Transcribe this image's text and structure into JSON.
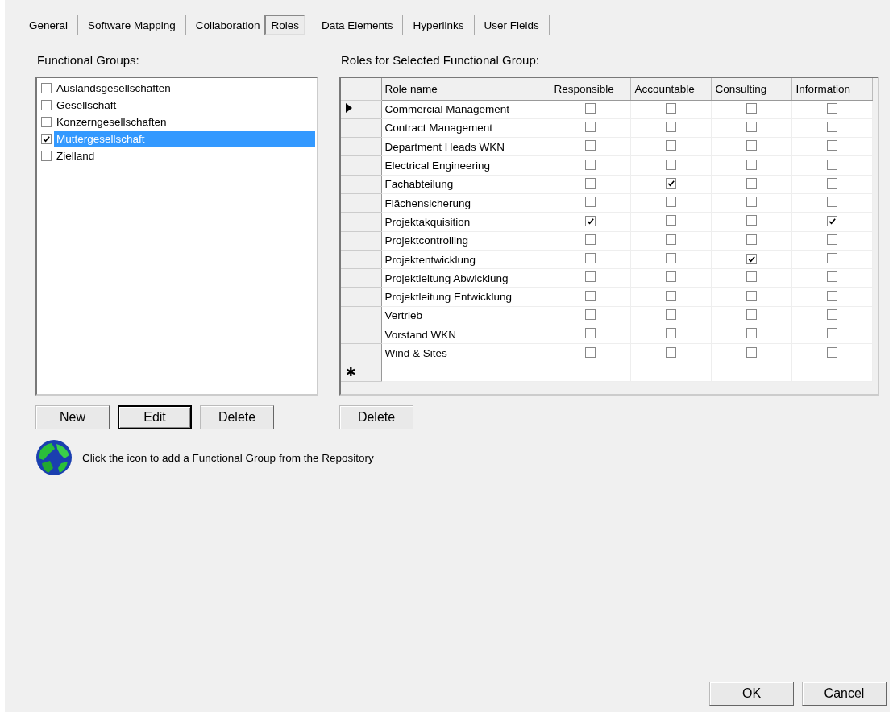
{
  "tabs": [
    {
      "label": "General",
      "selected": false
    },
    {
      "label": "Software Mapping",
      "selected": false
    },
    {
      "label": "Collaboration",
      "selected": false
    },
    {
      "label": "Roles",
      "selected": true
    },
    {
      "label": "Data Elements",
      "selected": false
    },
    {
      "label": "Hyperlinks",
      "selected": false
    },
    {
      "label": "User Fields",
      "selected": false
    }
  ],
  "functional_groups": {
    "label": "Functional Groups:",
    "items": [
      {
        "label": "Auslandsgesellschaften",
        "checked": false,
        "selected": false
      },
      {
        "label": "Gesellschaft",
        "checked": false,
        "selected": false
      },
      {
        "label": "Konzerngesellschaften",
        "checked": false,
        "selected": false
      },
      {
        "label": "Muttergesellschaft",
        "checked": true,
        "selected": true
      },
      {
        "label": "Zielland",
        "checked": false,
        "selected": false
      }
    ],
    "buttons": [
      {
        "label": "New",
        "default": false
      },
      {
        "label": "Edit",
        "default": true
      },
      {
        "label": "Delete",
        "default": false
      }
    ]
  },
  "roles": {
    "label": "Roles for Selected Functional Group:",
    "columns": [
      "Role name",
      "Responsible",
      "Accountable",
      "Consulting",
      "Information"
    ],
    "rows": [
      {
        "name": "Commercial Management",
        "current": true,
        "flags": [
          false,
          false,
          false,
          false
        ]
      },
      {
        "name": "Contract Management",
        "current": false,
        "flags": [
          false,
          false,
          false,
          false
        ]
      },
      {
        "name": "Department Heads WKN",
        "current": false,
        "flags": [
          false,
          false,
          false,
          false
        ]
      },
      {
        "name": "Electrical Engineering",
        "current": false,
        "flags": [
          false,
          false,
          false,
          false
        ]
      },
      {
        "name": "Fachabteilung",
        "current": false,
        "flags": [
          false,
          true,
          false,
          false
        ]
      },
      {
        "name": "Flächensicherung",
        "current": false,
        "flags": [
          false,
          false,
          false,
          false
        ]
      },
      {
        "name": "Projektakquisition",
        "current": false,
        "flags": [
          true,
          false,
          false,
          true
        ]
      },
      {
        "name": "Projektcontrolling",
        "current": false,
        "flags": [
          false,
          false,
          false,
          false
        ]
      },
      {
        "name": "Projektentwicklung",
        "current": false,
        "flags": [
          false,
          false,
          true,
          false
        ]
      },
      {
        "name": "Projektleitung Abwicklung",
        "current": false,
        "flags": [
          false,
          false,
          false,
          false
        ]
      },
      {
        "name": "Projektleitung Entwicklung",
        "current": false,
        "flags": [
          false,
          false,
          false,
          false
        ]
      },
      {
        "name": "Vertrieb",
        "current": false,
        "flags": [
          false,
          false,
          false,
          false
        ]
      },
      {
        "name": "Vorstand WKN",
        "current": false,
        "flags": [
          false,
          false,
          false,
          false
        ]
      },
      {
        "name": "Wind & Sites",
        "current": false,
        "flags": [
          false,
          false,
          false,
          false
        ]
      }
    ],
    "new_row_marker": "✱",
    "buttons": [
      {
        "label": "Delete",
        "default": false
      }
    ]
  },
  "repository_hint": "Click the icon to add a Functional Group from the Repository",
  "dialog_buttons": [
    "OK",
    "Cancel"
  ]
}
